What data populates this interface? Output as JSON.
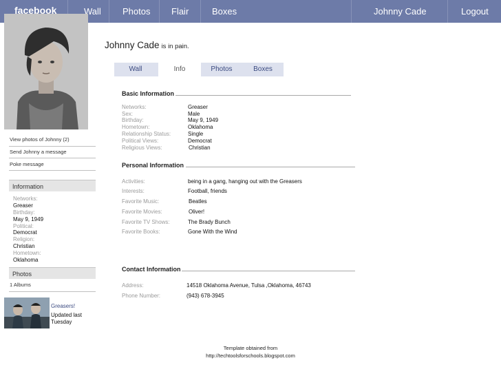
{
  "nav": {
    "logo": "facebook",
    "items": [
      "Wall",
      "Photos",
      "Flair",
      "Boxes"
    ],
    "user": "Johnny Cade",
    "logout": "Logout"
  },
  "sidebar": {
    "links": [
      "View photos of Johnny (2)",
      "Send Johnny a message",
      "Poke message"
    ],
    "information_title": "Information",
    "information": [
      {
        "label": "Networks:",
        "value": "Greaser"
      },
      {
        "label": "Birthday:",
        "value": "May 9, 1949"
      },
      {
        "label": "Political:",
        "value": "Democrat"
      },
      {
        "label": "Religion:",
        "value": "Christian"
      },
      {
        "label": "Hometown:",
        "value": "Oklahoma"
      }
    ],
    "photos_title": "Photos",
    "albums": "1 Albums",
    "album": {
      "name": "Greasers!",
      "updated": "Updated last Tuesday"
    }
  },
  "profile": {
    "name": "Johnny Cade",
    "status": "is in pain."
  },
  "tabs": [
    "Wall",
    "Info",
    "Photos",
    "Boxes"
  ],
  "basic": {
    "title": "Basic Information",
    "rows": [
      {
        "label": "Networks:",
        "value": "Greaser"
      },
      {
        "label": "Sex:",
        "value": "Male"
      },
      {
        "label": "Birthday:",
        "value": "May 9, 1949"
      },
      {
        "label": "Hometown:",
        "value": "Oklahoma"
      },
      {
        "label": "Relationship Status:",
        "value": "Single"
      },
      {
        "label": "Political Views:",
        "value": "Democrat"
      },
      {
        "label": "Religious Views:",
        "value": "Christian"
      }
    ]
  },
  "personal": {
    "title": "Personal Information",
    "rows": [
      {
        "label": "Activities:",
        "value": "being in a gang, hanging out with the Greasers"
      },
      {
        "label": "Interests:",
        "value": "Football, friends"
      },
      {
        "label": "Favorite Music:",
        "value": "Beatles"
      },
      {
        "label": "Favorite Movies:",
        "value": "Oliver!"
      },
      {
        "label": "Favorite TV Shows:",
        "value": "The Brady Bunch"
      },
      {
        "label": "Favorite Books:",
        "value": "Gone With the Wind"
      }
    ]
  },
  "contact": {
    "title": "Contact Information",
    "rows": [
      {
        "label": "Address:",
        "value": "14518 Oklahoma Avenue,  Tulsa ,Oklahoma, 46743"
      },
      {
        "label": "Phone Number:",
        "value": "(943) 678-3945"
      }
    ]
  },
  "credit": {
    "line1": "Template obtained from",
    "line2": "http://techtoolsforschools.blogspot.com"
  },
  "colors": {
    "nav_bg": "#6d7ba8",
    "tab_bg": "#dde1ee",
    "link": "#3b4a80",
    "label": "#9a9a9a"
  }
}
